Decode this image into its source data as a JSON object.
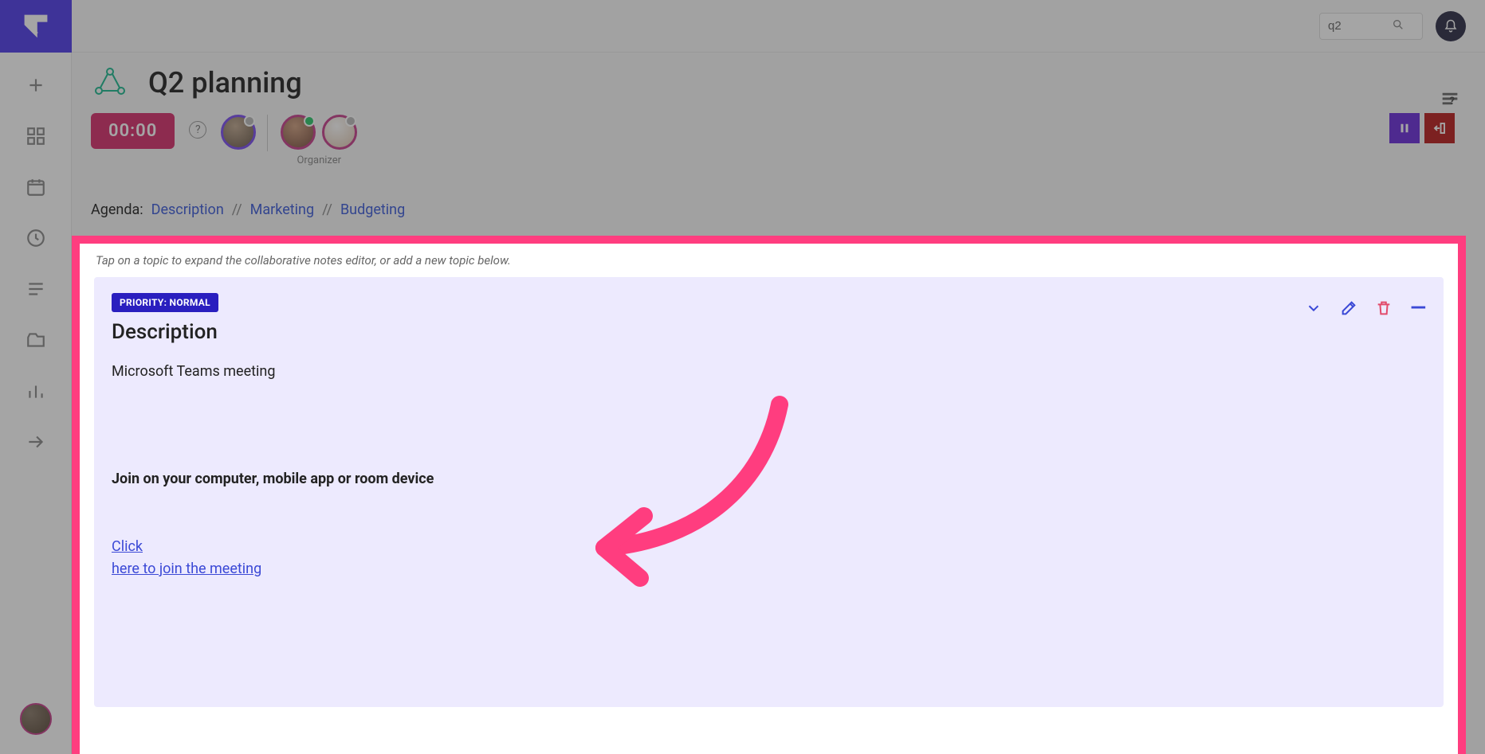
{
  "search": {
    "value": "q2"
  },
  "page": {
    "title": "Q2 planning"
  },
  "timer": {
    "value": "00:00"
  },
  "organizer_label": "Organizer",
  "agenda": {
    "label": "Agenda:",
    "items": [
      "Description",
      "Marketing",
      "Budgeting"
    ],
    "sep": "//"
  },
  "panel": {
    "hint": "Tap on a topic to expand the collaborative notes editor, or add a new topic below."
  },
  "topic": {
    "priority_label": "PRIORITY: NORMAL",
    "title": "Description",
    "line1": "Microsoft Teams meeting",
    "line_bold": "Join on your computer, mobile app or room device",
    "link1": "Click",
    "link2": "here to join the meeting"
  },
  "help_char": "?"
}
